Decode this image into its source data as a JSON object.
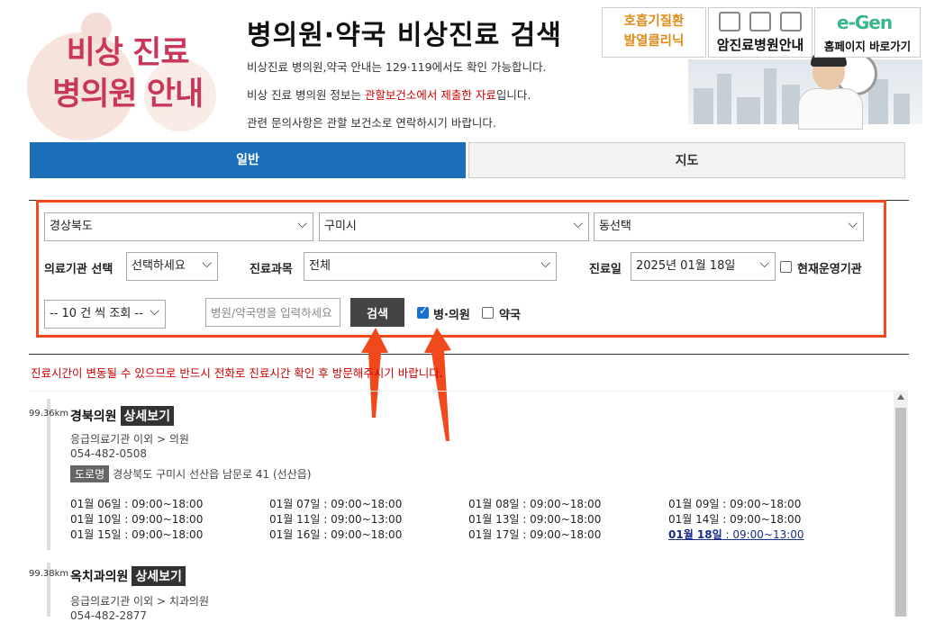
{
  "header": {
    "logo_line1": "비상 진료",
    "logo_line2": "병의원 안내",
    "title": "병의원·약국 비상진료 검색",
    "desc1": "비상진료 병의원,약국 안내는 129·119에서도 확인 가능합니다.",
    "desc2_pre": "비상 진료 병의원 정보는 ",
    "desc2_red": "관할보건소에서 제출한 자료",
    "desc2_post": "입니다.",
    "desc3": "관련 문의사항은 관할 보건소로 연락하시기 바랍니다.",
    "banner1_line1": "호흡기질환",
    "banner1_line2": "발열클리닉",
    "banner2_label": "암진료병원안내",
    "banner3_brand": "e-Gen",
    "banner3_label": "홈페이지 바로가기"
  },
  "tabs": {
    "general": "일반",
    "map": "지도"
  },
  "search": {
    "province": "경상북도",
    "city": "구미시",
    "dong": "동선택",
    "facility_label": "의료기관 선택",
    "facility_value": "선택하세요",
    "dept_label": "진료과목",
    "dept_value": "전체",
    "date_label": "진료일",
    "date_value": "2025년 01월 18일",
    "operating_label": "현재운영기관",
    "page_size": "-- 10 건 씩 조회 --",
    "name_placeholder": "병원/약국명을 입력하세요",
    "search_button": "검색",
    "hospital_label": "병·의원",
    "pharmacy_label": "약국",
    "hospital_checked": true,
    "pharmacy_checked": false,
    "operating_checked": false
  },
  "notice": "진료시간이 변동될 수 있으므로 반드시 전화로 진료시간 확인 후 방문해주시기 바랍니다.",
  "results": [
    {
      "distance": "99.36km",
      "name": "경북의원",
      "detail_label": "상세보기",
      "type": "응급의료기관 이외 > 의원",
      "phone": "054-482-0508",
      "road_label": "도로명",
      "address": "경상북도 구미시 선산읍 남문로 41 (선산읍)",
      "hours": [
        "01월 06일 : 09:00~18:00",
        "01월 07일 : 09:00~18:00",
        "01월 08일 : 09:00~18:00",
        "01월 09일 : 09:00~18:00",
        "01월 10일 : 09:00~18:00",
        "01월 11일 : 09:00~13:00",
        "01월 13일 : 09:00~18:00",
        "01월 14일 : 09:00~18:00",
        "01월 15일 : 09:00~18:00",
        "01월 16일 : 09:00~18:00",
        "01월 17일 : 09:00~18:00"
      ],
      "today_date": "01월 18일",
      "today_time": " : 09:00~13:00"
    },
    {
      "distance": "99.38km",
      "name": "옥치과의원",
      "detail_label": "상세보기",
      "type": "응급의료기관 이외 > 치과의원",
      "phone": "054-482-2877"
    }
  ]
}
